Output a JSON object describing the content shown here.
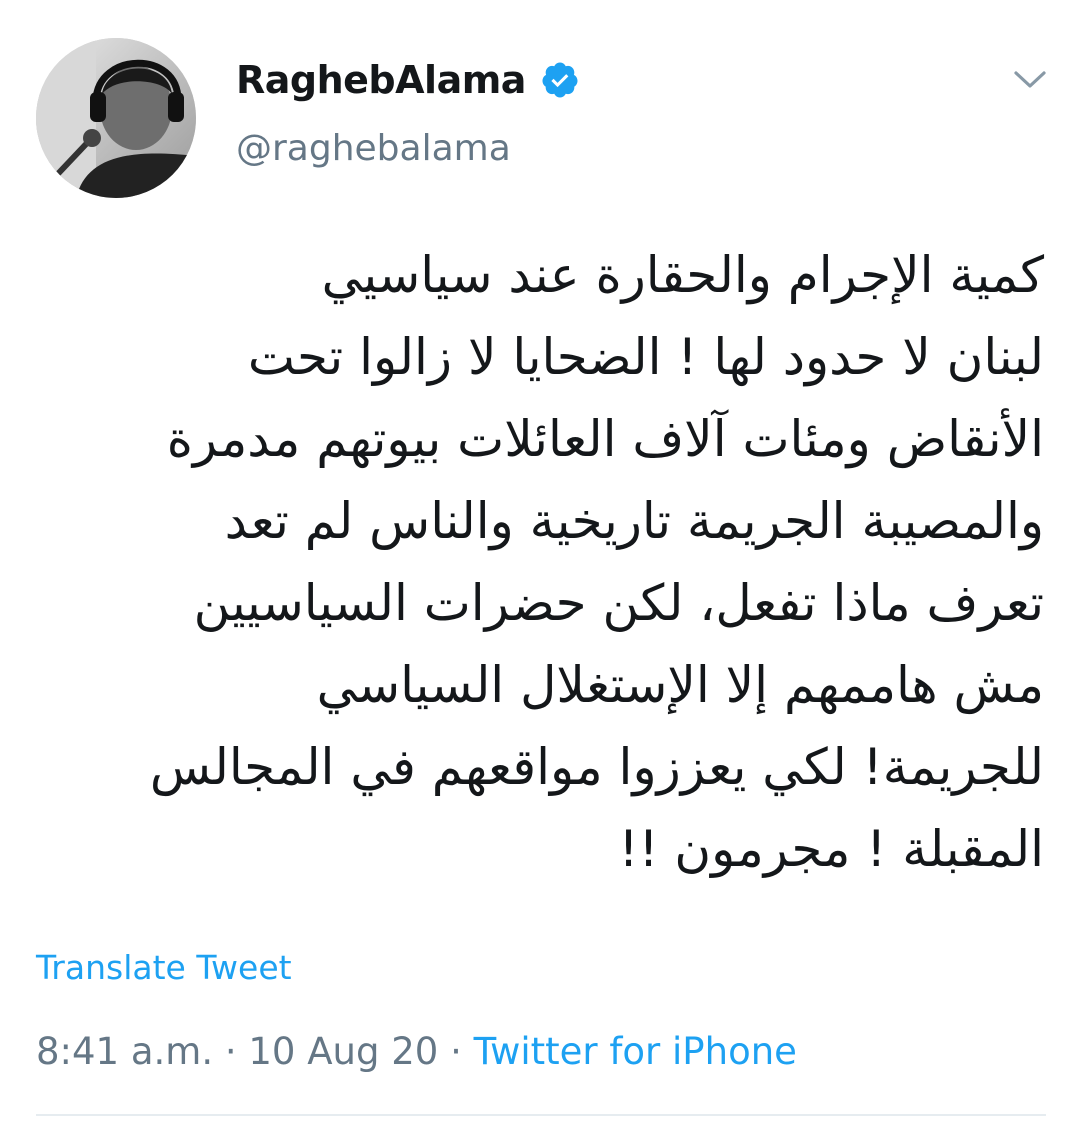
{
  "tweet": {
    "author": {
      "display_name": "RaghebAlama",
      "handle": "@raghebalama",
      "verified": true
    },
    "text_lines": [
      "كمية الإجرام والحقارة عند سياسيي",
      "لبنان لا حدود لها ! الضحايا لا زالوا تحت",
      "الأنقاض ومئات آلاف العائلات بيوتهم مدمرة",
      "والمصيبة الجريمة تاريخية والناس لم تعد",
      "تعرف ماذا تفعل، لكن حضرات السياسيين",
      "مش هاممهم إلا الإستغلال السياسي",
      "للجريمة! لكي يعززوا مواقعهم في المجالس",
      "المقبلة ! مجرمون !!"
    ],
    "translate_label": "Translate Tweet",
    "time": "8:41 a.m.",
    "date": "10 Aug 20",
    "separator": "·",
    "source": "Twitter for iPhone"
  },
  "colors": {
    "text": "#14171a",
    "secondary": "#657786",
    "accent": "#1da1f2",
    "divider": "#e6ecf0"
  },
  "icons": {
    "verified": "verified-badge-icon",
    "menu": "chevron-down-icon"
  }
}
